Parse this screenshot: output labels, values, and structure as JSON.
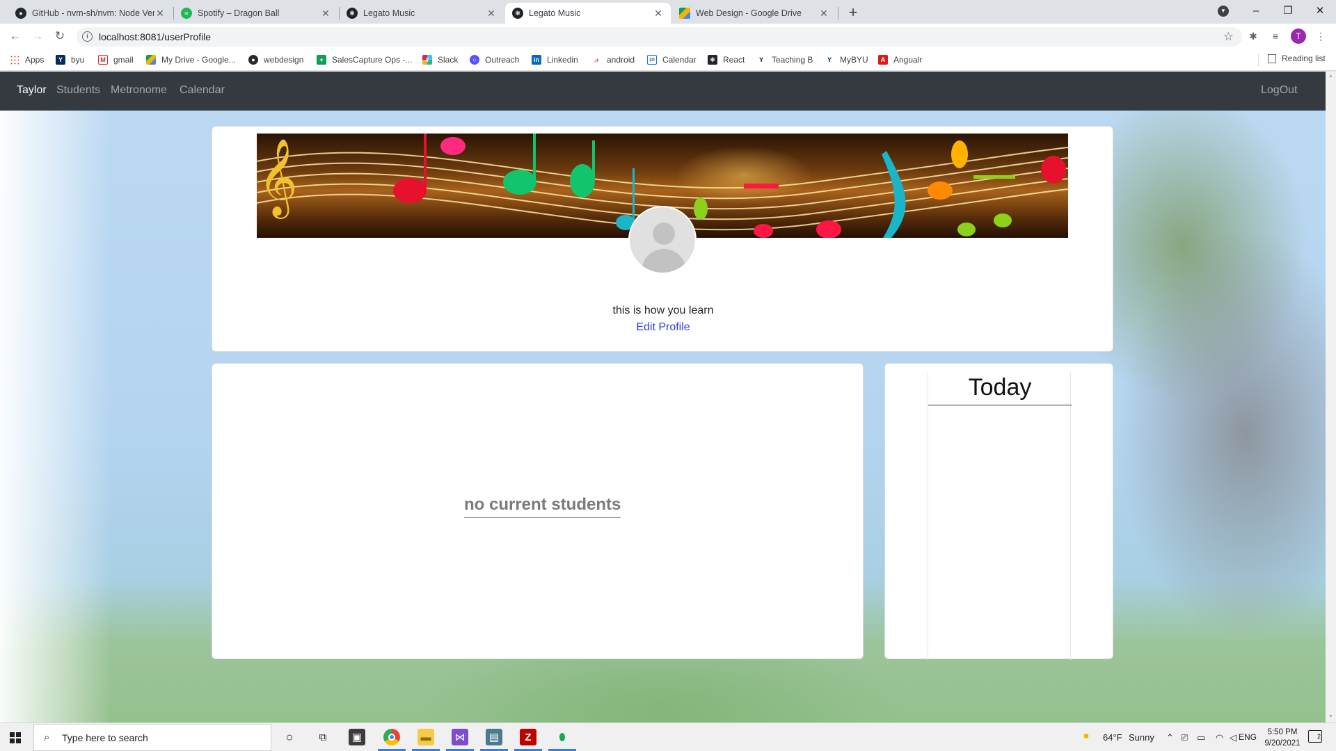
{
  "browser": {
    "tabs": [
      {
        "title": "GitHub - nvm-sh/nvm: Node Ver",
        "favicon": "github-icon"
      },
      {
        "title": "Spotify – Dragon Ball",
        "favicon": "spotify-icon"
      },
      {
        "title": "Legato Music",
        "favicon": "react-icon"
      },
      {
        "title": "Legato Music",
        "favicon": "react-icon",
        "active": true
      },
      {
        "title": "Web Design - Google Drive",
        "favicon": "google-drive-icon"
      }
    ],
    "url": "localhost:8081/userProfile",
    "profile_initial": "T",
    "bookmarks": [
      {
        "label": "Apps",
        "icon": "apps-grid-icon"
      },
      {
        "label": "byu",
        "icon": "byu-icon"
      },
      {
        "label": "gmail",
        "icon": "gmail-icon"
      },
      {
        "label": "My Drive - Google...",
        "icon": "google-drive-icon"
      },
      {
        "label": "webdesign",
        "icon": "github-icon"
      },
      {
        "label": "SalesCapture Ops -...",
        "icon": "sheets-icon"
      },
      {
        "label": "Slack",
        "icon": "slack-icon"
      },
      {
        "label": "Outreach",
        "icon": "outreach-icon"
      },
      {
        "label": "Linkedin",
        "icon": "linkedin-icon"
      },
      {
        "label": "android",
        "icon": "android-icon"
      },
      {
        "label": "Calendar",
        "icon": "calendar-icon"
      },
      {
        "label": "React",
        "icon": "react-icon"
      },
      {
        "label": "Teaching B",
        "icon": "byu-icon"
      },
      {
        "label": "MyBYU",
        "icon": "byu-icon"
      },
      {
        "label": "Angualr",
        "icon": "angular-icon"
      }
    ],
    "reading_list": "Reading list"
  },
  "app": {
    "nav": {
      "brand": "Taylor",
      "links": [
        "Students",
        "Metronome",
        "Calendar"
      ],
      "logout": "LogOut"
    },
    "profile": {
      "bio": "this is how you learn",
      "edit_link": "Edit Profile"
    },
    "students": {
      "empty_message": "no current students"
    },
    "today": {
      "title": "Today"
    }
  },
  "taskbar": {
    "search_placeholder": "Type here to search",
    "weather_temp": "64°F",
    "weather_text": "Sunny",
    "language": "ENG",
    "time": "5:50 PM",
    "date": "9/20/2021",
    "notification_count": "2"
  },
  "colors": {
    "navbar_bg": "#343a40",
    "link_blue": "#2f3bd9",
    "taskbar_active": "#3b7dd8",
    "profile_avatar_bg": "#9c27b0"
  }
}
